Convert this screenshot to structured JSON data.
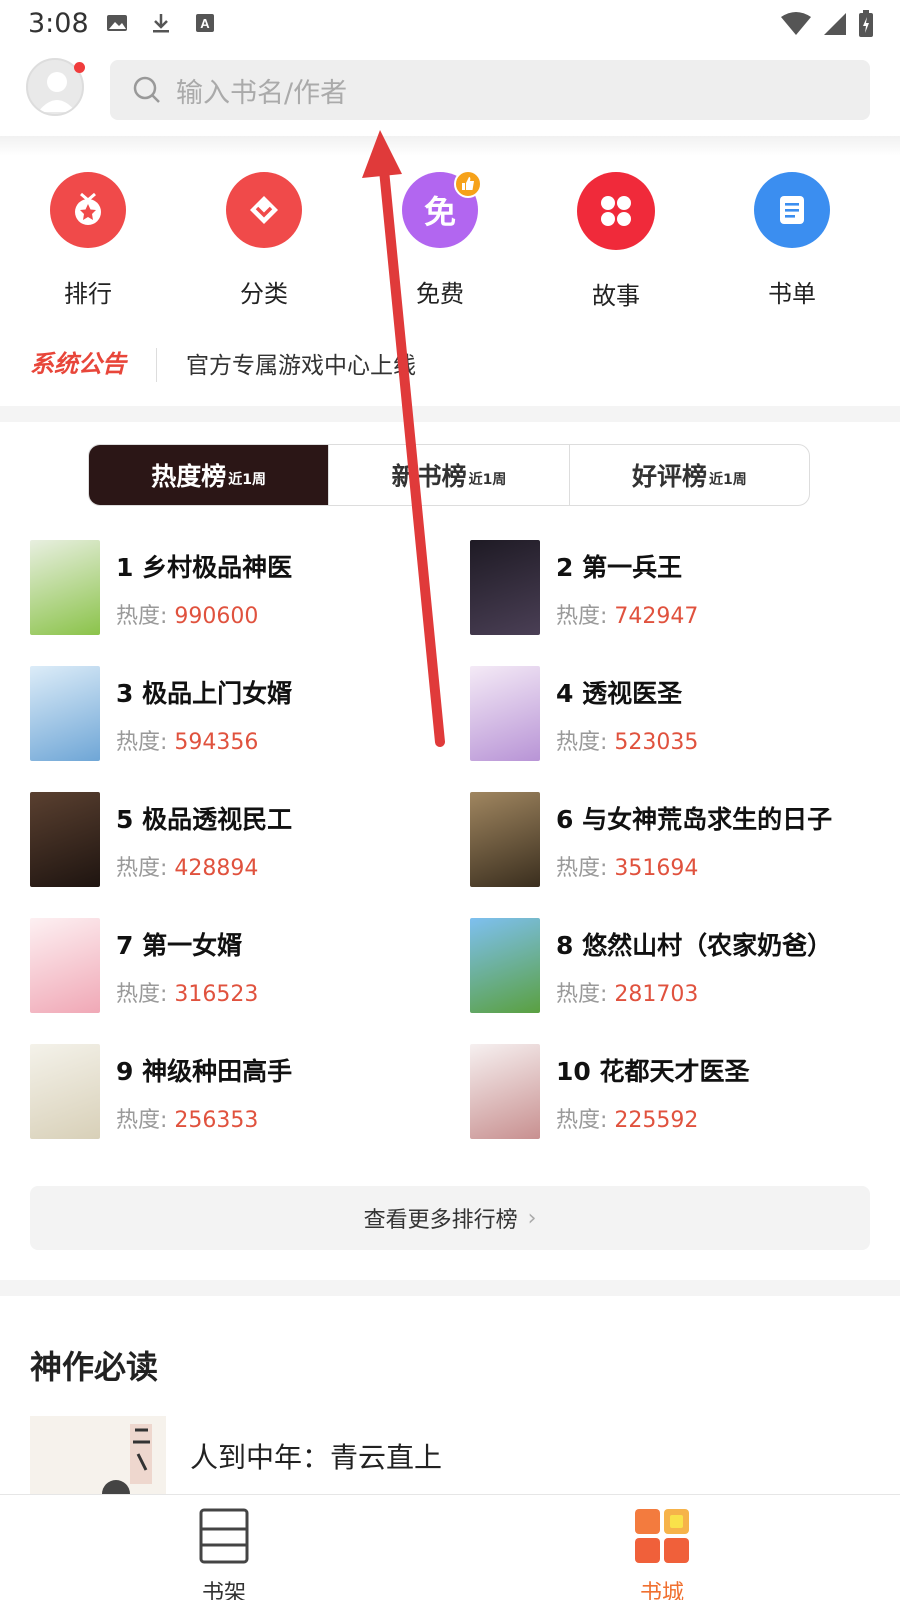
{
  "status_bar": {
    "time": "3:08"
  },
  "search": {
    "placeholder": "输入书名/作者"
  },
  "quick_nav": [
    {
      "label": "排行",
      "icon": "medal-icon",
      "color": "#f04a4a"
    },
    {
      "label": "分类",
      "icon": "diamond-icon",
      "color": "#f04a4a"
    },
    {
      "label": "免费",
      "icon": "free-icon",
      "color": "#b266f0",
      "glyph": "免"
    },
    {
      "label": "故事",
      "icon": "grid-icon",
      "color": "#f02a3a"
    },
    {
      "label": "书单",
      "icon": "list-doc-icon",
      "color": "#3b8ef0"
    }
  ],
  "notice": {
    "tag": "系统公告",
    "text": "官方专属游戏中心上线"
  },
  "tabs": [
    {
      "label": "热度榜",
      "sub": "近1周",
      "active": true
    },
    {
      "label": "新书榜",
      "sub": "近1周",
      "active": false
    },
    {
      "label": "好评榜",
      "sub": "近1周",
      "active": false
    }
  ],
  "rankings": {
    "heat_label": "热度:",
    "items": [
      {
        "title": "1 乡村极品神医",
        "heat": "990600",
        "cover_color": "#8bc34a"
      },
      {
        "title": "2 第一兵王",
        "heat": "742947",
        "cover_color": "#3a2f3f"
      },
      {
        "title": "3 极品上门女婿",
        "heat": "594356",
        "cover_color": "#9ec6e6"
      },
      {
        "title": "4 透视医圣",
        "heat": "523035",
        "cover_color": "#d8c4e6"
      },
      {
        "title": "5 极品透视民工",
        "heat": "428894",
        "cover_color": "#3a2a22"
      },
      {
        "title": "6 与女神荒岛求生的日子",
        "heat": "351694",
        "cover_color": "#6a5a3a"
      },
      {
        "title": "7 第一女婿",
        "heat": "316523",
        "cover_color": "#f6d6da"
      },
      {
        "title": "8 悠然山村（农家奶爸）",
        "heat": "281703",
        "cover_color": "#5aa6e6"
      },
      {
        "title": "9 神级种田高手",
        "heat": "256353",
        "cover_color": "#ece8dc"
      },
      {
        "title": "10 花都天才医圣",
        "heat": "225592",
        "cover_color": "#e8e0e0"
      }
    ]
  },
  "more_button": {
    "label": "查看更多排行榜",
    "chevron": "›"
  },
  "must_read": {
    "title": "神作必读",
    "first_book": "人到中年：青云直上"
  },
  "bottom_nav": [
    {
      "label": "书架",
      "active": false,
      "color": "#333333"
    },
    {
      "label": "书城",
      "active": true,
      "color": "#f07030"
    }
  ],
  "colors": {
    "accent": "#e0523e",
    "tab_active_bg": "#2b1616",
    "arrow": "#e03a3a"
  }
}
